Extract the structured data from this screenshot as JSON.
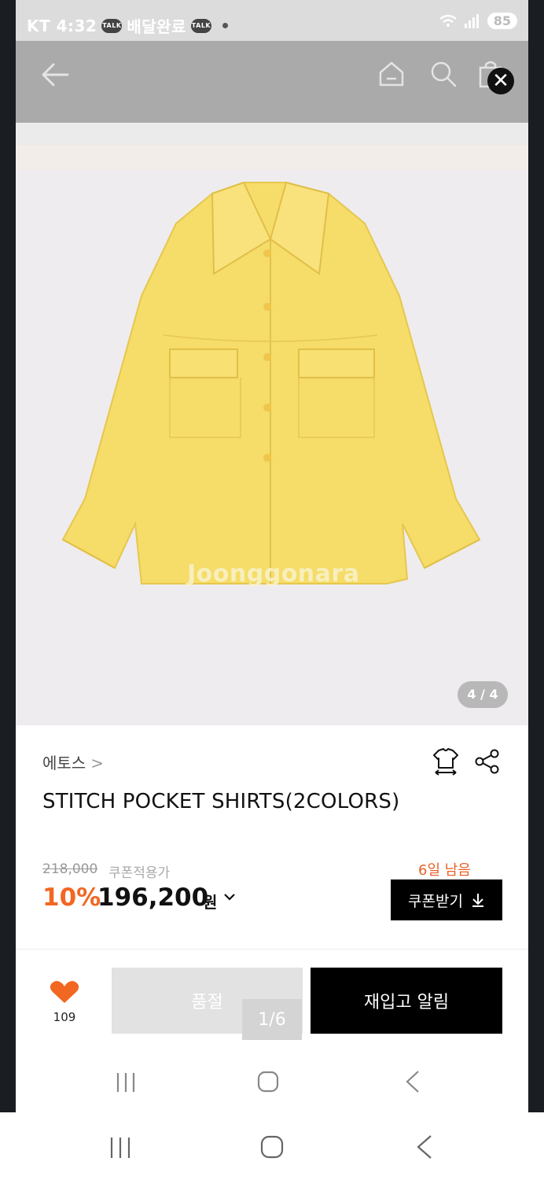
{
  "status_bar": {
    "time": "KT 4:32",
    "delivery_text": "배달완료",
    "battery": "85"
  },
  "nav": {
    "back_icon": "arrow-left-icon",
    "home_icon": "home-icon",
    "search_icon": "search-icon",
    "bag_icon": "shopping-bag-icon",
    "close_icon": "close-icon"
  },
  "image": {
    "watermark": "Joonggonara",
    "counter": "4 / 4",
    "shirt_color": "#f6dc68"
  },
  "product": {
    "brand": "에토스",
    "title": "STITCH POCKET SHIRTS(2COLORS)",
    "original_price": "218,000",
    "coupon_label": "쿠폰적용가",
    "days_left": "6일 남음",
    "discount": "10%",
    "price": "196,200",
    "currency": "원",
    "coupon_button": "쿠폰받기"
  },
  "actions": {
    "like_count": "109",
    "soldout_label": "품절",
    "restock_label": "재입고 알림",
    "page_indicator": "1/6"
  },
  "colors": {
    "accent": "#f26722",
    "heart": "#f26722",
    "black": "#000000"
  }
}
